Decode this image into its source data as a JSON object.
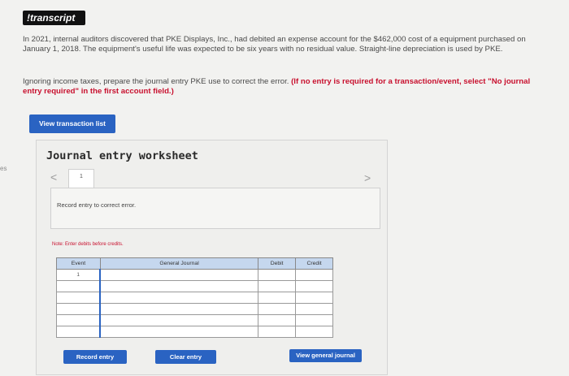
{
  "side_label": "es",
  "header": {
    "badge": "!transcript"
  },
  "problem": {
    "text": "In 2021, internal auditors discovered that PKE Displays, Inc., had debited an expense account for the $462,000 cost of a equipment purchased on January 1, 2018. The equipment's useful life was expected to be six years with no residual value. Straight-line depreciation is used by PKE."
  },
  "instruction": {
    "text": "Ignoring income taxes, prepare the journal entry PKE use to correct the error.",
    "emphasis": "(If no entry is required for a transaction/event, select \"No journal entry required\" in the first account field.)"
  },
  "buttons": {
    "view_transaction_list": "View transaction list",
    "record_entry": "Record entry",
    "clear_entry": "Clear entry",
    "view_general_journal": "View general journal"
  },
  "worksheet": {
    "title": "Journal entry worksheet",
    "prev_arrow": "<",
    "next_arrow": ">",
    "page": "1",
    "entry_description": "Record entry to correct error.",
    "note": "Note: Enter debits before credits."
  },
  "journal": {
    "headers": {
      "event": "Event",
      "general_journal": "General Journal",
      "debit": "Debit",
      "credit": "Credit"
    },
    "rows": [
      {
        "event": "1",
        "account": "",
        "debit": "",
        "credit": ""
      },
      {
        "event": "",
        "account": "",
        "debit": "",
        "credit": ""
      },
      {
        "event": "",
        "account": "",
        "debit": "",
        "credit": ""
      },
      {
        "event": "",
        "account": "",
        "debit": "",
        "credit": ""
      },
      {
        "event": "",
        "account": "",
        "debit": "",
        "credit": ""
      },
      {
        "event": "",
        "account": "",
        "debit": "",
        "credit": ""
      }
    ]
  },
  "colors": {
    "button_blue": "#2a63c2",
    "header_blue": "#c5d7ee",
    "emphasis_red": "#c8102e"
  }
}
